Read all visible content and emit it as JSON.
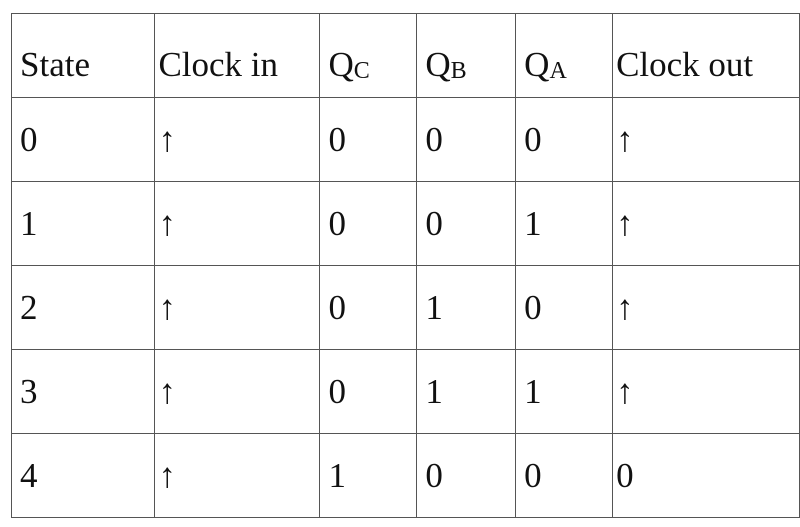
{
  "table": {
    "headers": [
      {
        "main": "State",
        "sub": ""
      },
      {
        "main": "Clock in",
        "sub": ""
      },
      {
        "main": "Q",
        "sub": "C"
      },
      {
        "main": "Q",
        "sub": "B"
      },
      {
        "main": "Q",
        "sub": "A"
      },
      {
        "main": "Clock out",
        "sub": ""
      }
    ],
    "rows": [
      [
        "0",
        "↑",
        "0",
        "0",
        "0",
        "↑"
      ],
      [
        "1",
        "↑",
        "0",
        "0",
        "1",
        "↑"
      ],
      [
        "2",
        "↑",
        "0",
        "1",
        "0",
        "↑"
      ],
      [
        "3",
        "↑",
        "0",
        "1",
        "1",
        "↑"
      ],
      [
        "4",
        "↑",
        "1",
        "0",
        "0",
        "0"
      ]
    ]
  }
}
